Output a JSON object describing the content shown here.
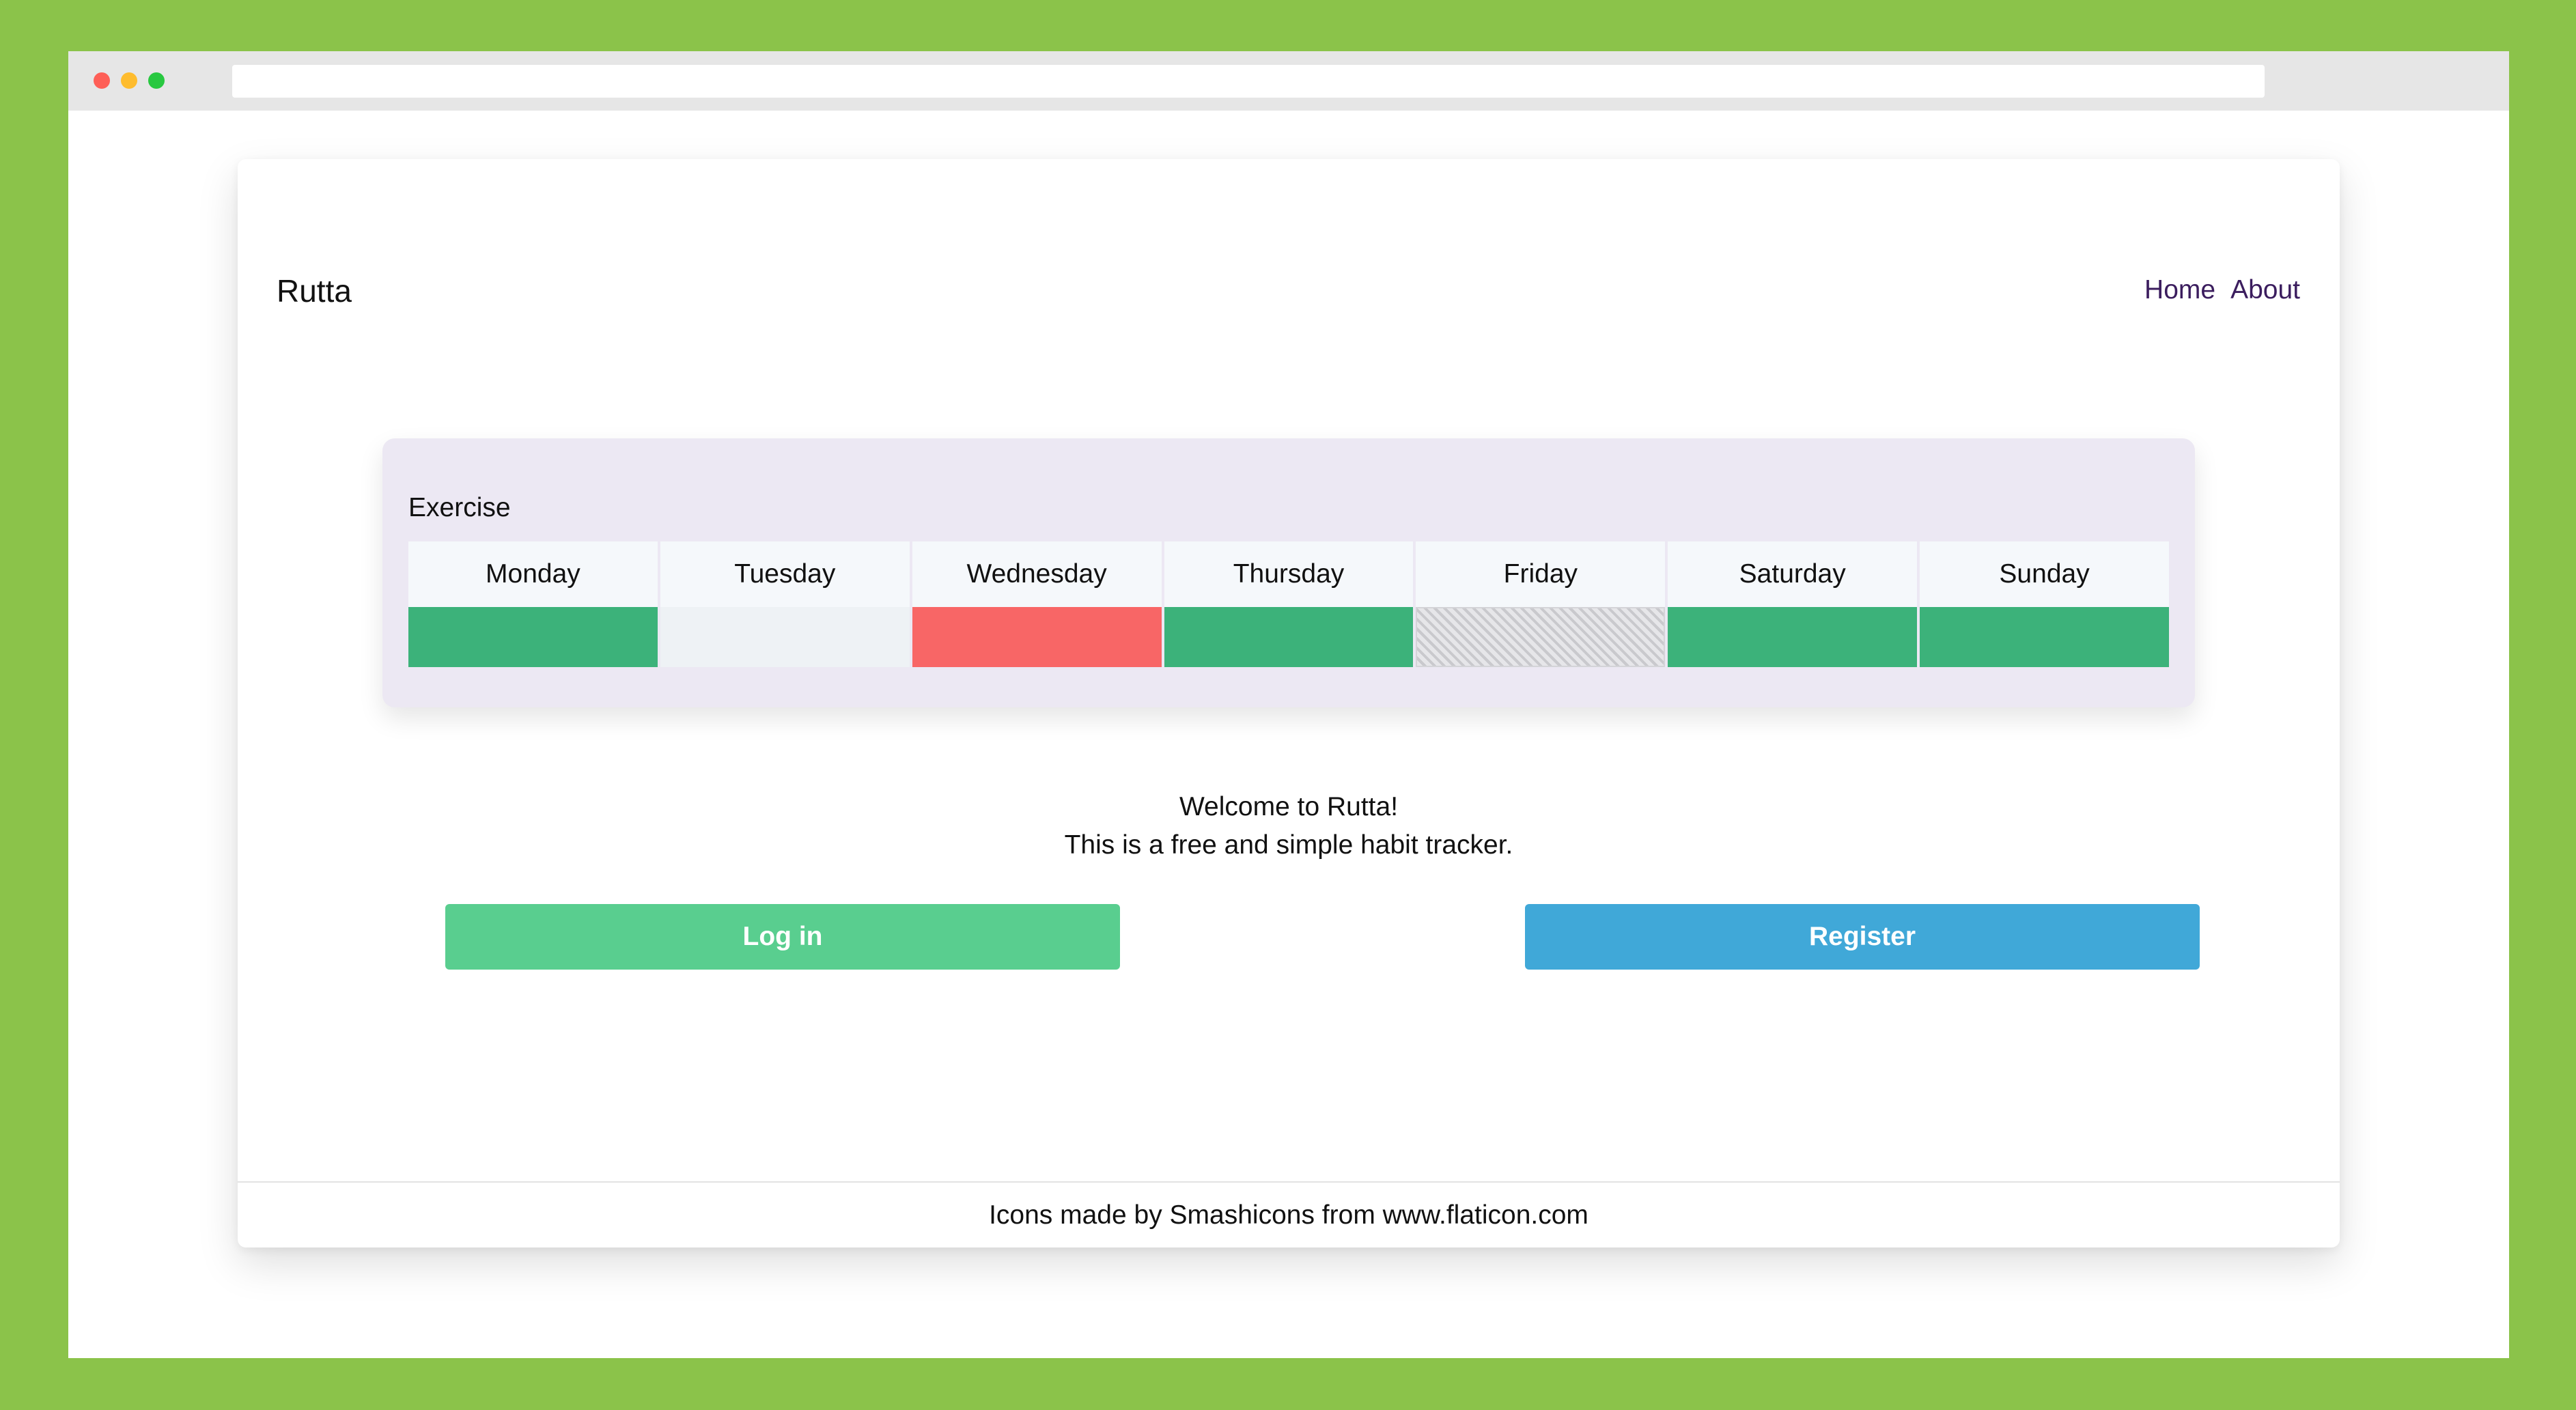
{
  "app": {
    "brand": "Rutta",
    "nav": [
      {
        "label": "Home"
      },
      {
        "label": "About"
      }
    ]
  },
  "habit": {
    "title": "Exercise",
    "days": [
      {
        "label": "Monday",
        "status": "done"
      },
      {
        "label": "Tuesday",
        "status": "empty"
      },
      {
        "label": "Wednesday",
        "status": "missed"
      },
      {
        "label": "Thursday",
        "status": "done"
      },
      {
        "label": "Friday",
        "status": "skipped"
      },
      {
        "label": "Saturday",
        "status": "done"
      },
      {
        "label": "Sunday",
        "status": "done"
      }
    ]
  },
  "welcome": {
    "line1": "Welcome to Rutta!",
    "line2": "This is a free and simple habit tracker."
  },
  "buttons": {
    "login": "Log in",
    "register": "Register"
  },
  "footer": {
    "text": "Icons made by Smashicons from www.flaticon.com"
  },
  "colors": {
    "background": "#8bc34a",
    "done": "#3cb27a",
    "missed": "#f86666",
    "empty": "#eef2f5",
    "login_button": "#59ce8f",
    "register_button": "#40a8d8",
    "panel": "#ece8f3"
  }
}
